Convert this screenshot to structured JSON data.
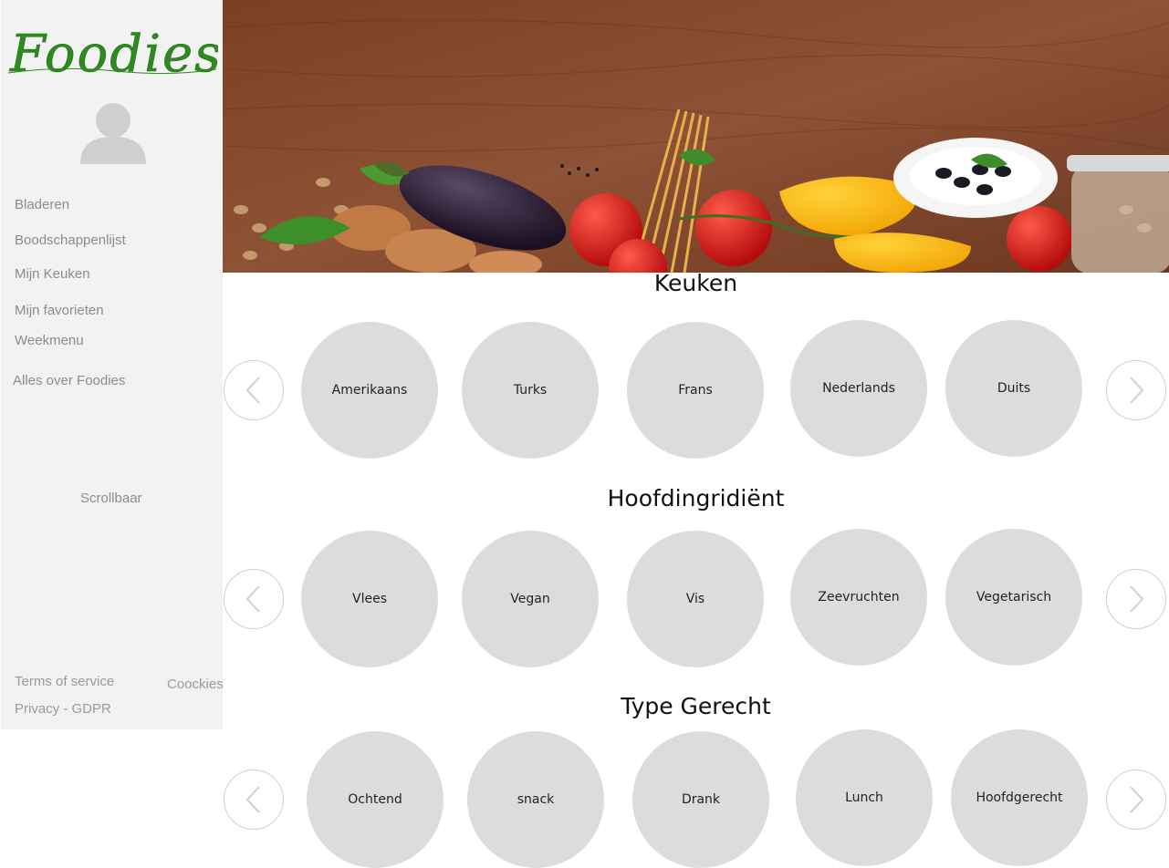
{
  "sidebar": {
    "logo_text": "Foodies",
    "nav": [
      {
        "label": "Bladeren"
      },
      {
        "label": "Boodschappenlijst"
      },
      {
        "label": "Mijn Keuken"
      },
      {
        "label": "Mijn favorieten"
      },
      {
        "label": "Weekmenu"
      },
      {
        "label": "Alles over Foodies"
      }
    ],
    "scroll_label": "Scrollbaar",
    "footer": {
      "terms": "Terms of service",
      "cookies": "Coockies",
      "privacy": "Privacy - GDPR"
    }
  },
  "sections": [
    {
      "title": "Keuken",
      "items": [
        "Amerikaans",
        "Turks",
        "Frans",
        "Nederlands",
        "Duits"
      ]
    },
    {
      "title": "Hoofdingridiënt",
      "items": [
        "Vlees",
        "Vegan",
        "Vis",
        "Zeevruchten",
        "Vegetarisch"
      ]
    },
    {
      "title": "Type Gerecht",
      "items": [
        "Ochtend",
        "snack",
        "Drank",
        "Lunch",
        "Hoofdgerecht"
      ]
    }
  ],
  "colors": {
    "sidebar_bg": "#f2f2f2",
    "logo_green": "#2e8b1f",
    "circle_bg": "#dcdcdc",
    "nav_text": "#8c8c8c"
  }
}
